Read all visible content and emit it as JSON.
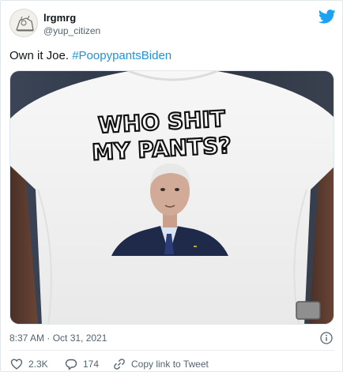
{
  "author": {
    "name": "lrgmrg",
    "handle": "@yup_citizen"
  },
  "tweet": {
    "text": "Own it Joe. ",
    "hashtag": "#PoopypantsBiden"
  },
  "media": {
    "shirt_text_line1": "WHO SHIT",
    "shirt_text_line2": "MY PANTS?"
  },
  "meta": {
    "timestamp": "8:37 AM · Oct 31, 2021"
  },
  "actions": {
    "likes": "2.3K",
    "replies": "174",
    "share_label": "Copy link to Tweet"
  },
  "colors": {
    "link": "#1b95e0",
    "muted": "#536471",
    "twitter_blue": "#1da1f2",
    "shirt": "#f2f2f2",
    "wall": "#2c3545"
  },
  "icons": [
    "twitter-bird-icon",
    "info-icon",
    "heart-icon",
    "reply-icon",
    "link-icon"
  ]
}
